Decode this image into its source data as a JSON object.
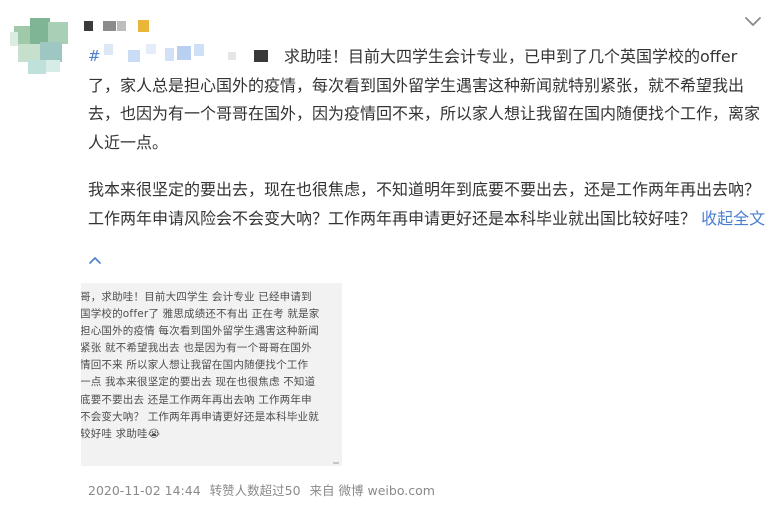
{
  "post": {
    "hashtag": "#",
    "first_line": "求助哇！目前大四学生会计专业，已申到了几个英国学校的offer",
    "lines": [
      "了，家人总是担心国外的疫情，每次看到国外留学生遇害这种新闻就特别紧张，就不希望我出",
      "去，也因为有一个哥哥在国外，因为疫情回不来，所以家人想让我留在国内随便找个工作，离家",
      "人近一点。"
    ],
    "para2_lines": [
      "我本来很坚定的要出去，现在也很焦虑，不知道明年到底要不要出去，还是工作两年再出去吶？"
    ],
    "para2_last": "工作两年申请风险会不会变大吶？工作两年再申请更好还是本科毕业就出国比较好哇？ ",
    "collapse_label": "收起全文"
  },
  "note": {
    "lines": [
      "哥，求助哇！目前大四学生 会计专业 已经申请到",
      "国学校的offer了 雅思成绩还不有出 正在考 就是家",
      "担心国外的疫情 每次看到国外留学生遇害这种新闻",
      "紧张 就不希望我出去 也是因为有一个哥哥在国外",
      "情回不来 所以家人想让我留在国内随便找个工作",
      "一点 我本来很坚定的要出去 现在也很焦虑 不知道",
      "底要不要出去 还是工作两年再出去吶 工作两年申",
      "不会变大吶？ 工作两年再申请更好还是本科毕业就",
      "较好哇 求助哇😭"
    ]
  },
  "meta": {
    "time": "2020-11-02 14:44",
    "reposts": "转赞人数超过50",
    "source": "来自 微博 weibo.com"
  },
  "colors": {
    "link": "#4a7ed0",
    "text": "#333333",
    "meta": "#8a8a8a",
    "image_bg": "#f2f2f2"
  },
  "icons": {
    "menu": "chevron-down-icon",
    "collapse": "chevron-up-icon"
  }
}
